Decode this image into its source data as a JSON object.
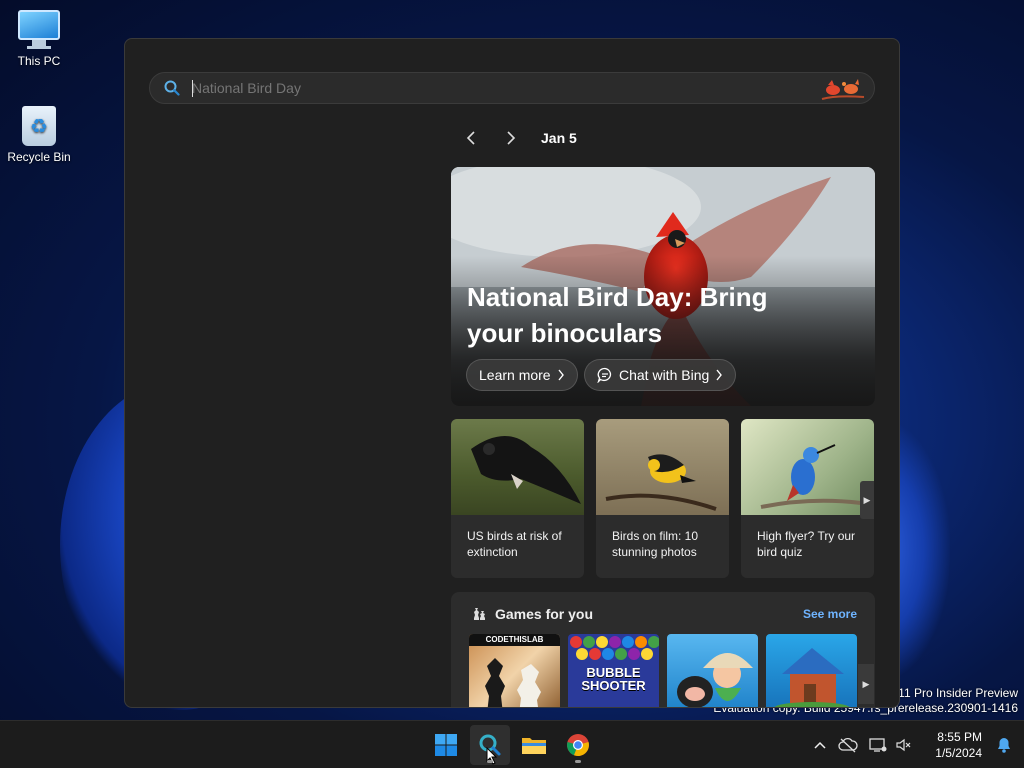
{
  "desktop": {
    "icons": [
      {
        "label": "This PC"
      },
      {
        "label": "Recycle Bin"
      }
    ],
    "watermark": {
      "line1": "s 11 Pro Insider Preview",
      "line2": "Evaluation copy. Build 25947.rs_prerelease.230901-1416"
    }
  },
  "search": {
    "value": "",
    "placeholder": "National Bird Day"
  },
  "highlights": {
    "date": "Jan 5",
    "hero": {
      "title": "National Bird Day: Bring your binoculars",
      "learn_more": "Learn more",
      "chat": "Chat with Bing"
    },
    "cards": [
      {
        "title": "US birds at risk of extinction"
      },
      {
        "title": "Birds on film: 10 stunning photos"
      },
      {
        "title": "High flyer? Try our bird quiz"
      }
    ],
    "games": {
      "title": "Games for you",
      "see_more": "See more",
      "tiles": [
        {
          "label": "CODETHISLAB"
        },
        {
          "label": "BUBBLE SHOOTER"
        },
        {
          "label": ""
        },
        {
          "label": ""
        }
      ]
    }
  },
  "taskbar": {
    "time": "8:55 PM",
    "date": "1/5/2024"
  },
  "colors": {
    "accent": "#6fb4ff",
    "panel": "#202020",
    "card": "#2c2c2c"
  }
}
